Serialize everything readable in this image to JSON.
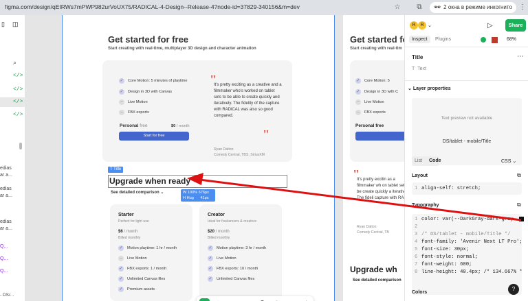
{
  "browser": {
    "url": "figma.com/design/qEIRWs7mPWP982urVoUX75/RADICAL-4-Design--Release-4?node-id=37829-340156&m=dev",
    "incognito_label": "2 окна в режиме инкогнито"
  },
  "left_panel": {
    "snippets": [
      "Q...",
      "Q...",
      "Q..."
    ],
    "texts": [
      "edias",
      "ar a...",
      "edias",
      "ar a...",
      "edias",
      "ar a...",
      "- DS/..."
    ]
  },
  "page": {
    "heading": "Get started for free",
    "subheading": "Start creating with real-time, multiplayer 3D design and character animation",
    "features": [
      "Core Motion: 5 minutes of playtime",
      "Design in 3D with Canvas",
      "Live Motion",
      "FBX exports"
    ],
    "plan_personal": "Personal",
    "plan_free": "free",
    "price": "$0",
    "per_month": "/ month",
    "start_button": "Start for free",
    "quote": "It's pretty exciting as a creative and a filmmaker who's worked on tablet sets to be able to create quickly and iteratively. The fidelity of the capture with RADiCAL was also so good compared.",
    "author": "Ryan Dalton",
    "author_role": "Comedy Central, TBS, SiriusXM",
    "title_tag": "Title",
    "upgrade_heading": "Upgrade when ready",
    "see_comparison": "See detailed comparison",
    "size_w": "W",
    "size_w_val": "100%",
    "size_w_px": "676px",
    "size_h": "H",
    "size_h_val": "Hug",
    "size_h_px": "41px",
    "starter": {
      "name": "Starter",
      "tag": "Perfect for light use",
      "price": "$6",
      "per": "/ month",
      "billed": "Billed monthly",
      "features": [
        "Motion playtime: 1 hr / month",
        "Live Motion",
        "FBX exports: 1 / month",
        "Unlimited Canvas files",
        "Premium assets"
      ]
    },
    "creator": {
      "name": "Creator",
      "tag": "Ideal for freelancers & creators",
      "price": "$20",
      "per": "/ month",
      "billed": "Billed monthly",
      "features": [
        "Motion playtime: 3 hr / month",
        "Live Motion",
        "FBX exports: 10 / month",
        "Unlimited Canvas files"
      ]
    }
  },
  "side_frame": {
    "heading": "Get started for",
    "sub": "Start creating with real-tim",
    "features": [
      "Core Motion: 5",
      "Design in 3D with C",
      "Live Motion",
      "FBX exports"
    ],
    "personal": "Personal free",
    "quote": "It's pretty excitin as a filmmaker wh on tablet sets to be create quickly a iteratively. The fideli capture with RAD",
    "author": "Ryan Dalton",
    "author_role": "Comedy Central, TB",
    "upgrade": "Upgrade wh",
    "see": "See detailed comparison"
  },
  "right_panel": {
    "share": "Share",
    "tab_inspect": "Inspect",
    "tab_plugins": "Plugins",
    "zoom": "68%",
    "title": "Title",
    "text_label": "Text",
    "layer_properties": "Layer properties",
    "preview_note": "Text preview not available",
    "preview_name": "DS/tablet - mobile/Title",
    "list_tab": "List",
    "code_tab": "Code",
    "lang": "CSS",
    "layout_label": "Layout",
    "layout_code": "align-self: stretch;",
    "typography_label": "Typography",
    "code_lines": [
      "color: var(--DarkGray-dark-gray",
      "",
      "/* DS/tablet - mobile/Title */",
      "font-family: 'Avenir Next LT Pro';",
      "font-size: 30px;",
      "font-style: normal;",
      "font-weight: 600;",
      "line-height: 40.4px; /* 134.667% */"
    ],
    "colors_label": "Colors",
    "help": "?"
  },
  "colors": {
    "accent": "#4466cc",
    "share_green": "#1bb15b",
    "arrow_red": "#dd1111",
    "selection": "#4b8ef0"
  }
}
